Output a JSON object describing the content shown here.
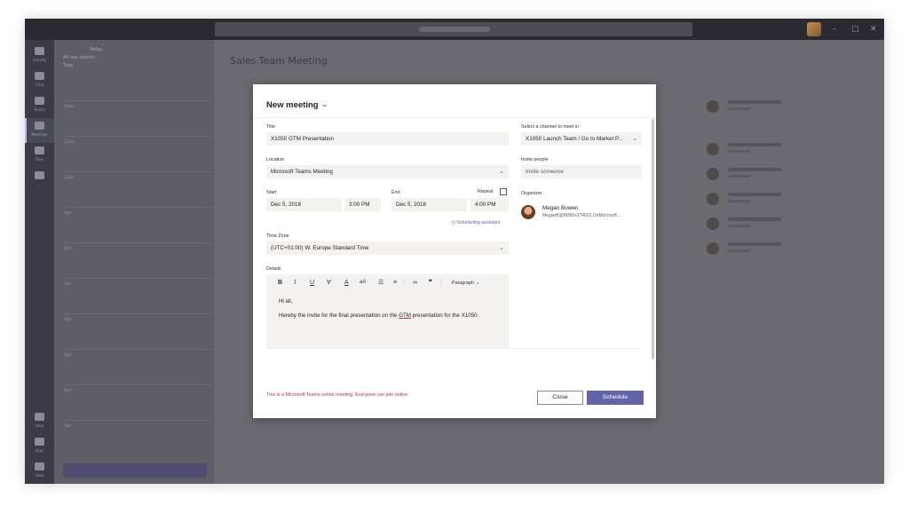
{
  "app": {
    "page_heading": "Sales Team Meeting"
  },
  "left_pane": {
    "nav_label": "Today",
    "date_label": "All day events",
    "subtitle": "Tues",
    "hours": [
      "10am",
      "11am",
      "12pm",
      "1pm",
      "2pm",
      "3pm",
      "4pm",
      "5pm",
      "6pm",
      "7pm"
    ]
  },
  "rail": {
    "items": [
      "Activity",
      "Chat",
      "Teams",
      "Meetings",
      "Files",
      "...",
      "Help",
      "Apps",
      "Help"
    ]
  },
  "dialog": {
    "title": "New meeting",
    "title_field": {
      "label": "Title",
      "value": "X1050 GTM Presentation"
    },
    "location": {
      "label": "Location",
      "value": "Microsoft Teams Meeting"
    },
    "start": {
      "label": "Start",
      "date": "Dec 5, 2018",
      "time": "3:00 PM"
    },
    "end": {
      "label": "End",
      "date": "Dec 5, 2018",
      "time": "4:00 PM"
    },
    "repeat_label": "Repeat",
    "scheduling_assistant": "Scheduling assistant",
    "timezone": {
      "label": "Time Zone",
      "value": "(UTC+01:00) W. Europe Standard Time"
    },
    "details": {
      "label": "Details",
      "paragraph_style": "Paragraph",
      "greeting": "Hi all,",
      "body_before": "Hereby the invite for the final presentation on the ",
      "body_flagged": "GTM",
      "body_after": " presentation for the X1050."
    },
    "channel": {
      "label": "Select a channel to meet in",
      "value": "X1050 Launch Team / Go to Market P..."
    },
    "invite": {
      "label": "Invite people",
      "placeholder": "Invite someone"
    },
    "organizer": {
      "label": "Organizer",
      "name": "Megan Bowen",
      "email": "MeganB@M365x374022.OnMicrosoft..."
    },
    "note": "This is a Microsoft Teams online meeting. Everyone can join online.",
    "close_label": "Close",
    "schedule_label": "Schedule"
  },
  "colors": {
    "accent": "#6264a7",
    "warning": "#c4314b",
    "field_bg": "#f3f2f1"
  }
}
